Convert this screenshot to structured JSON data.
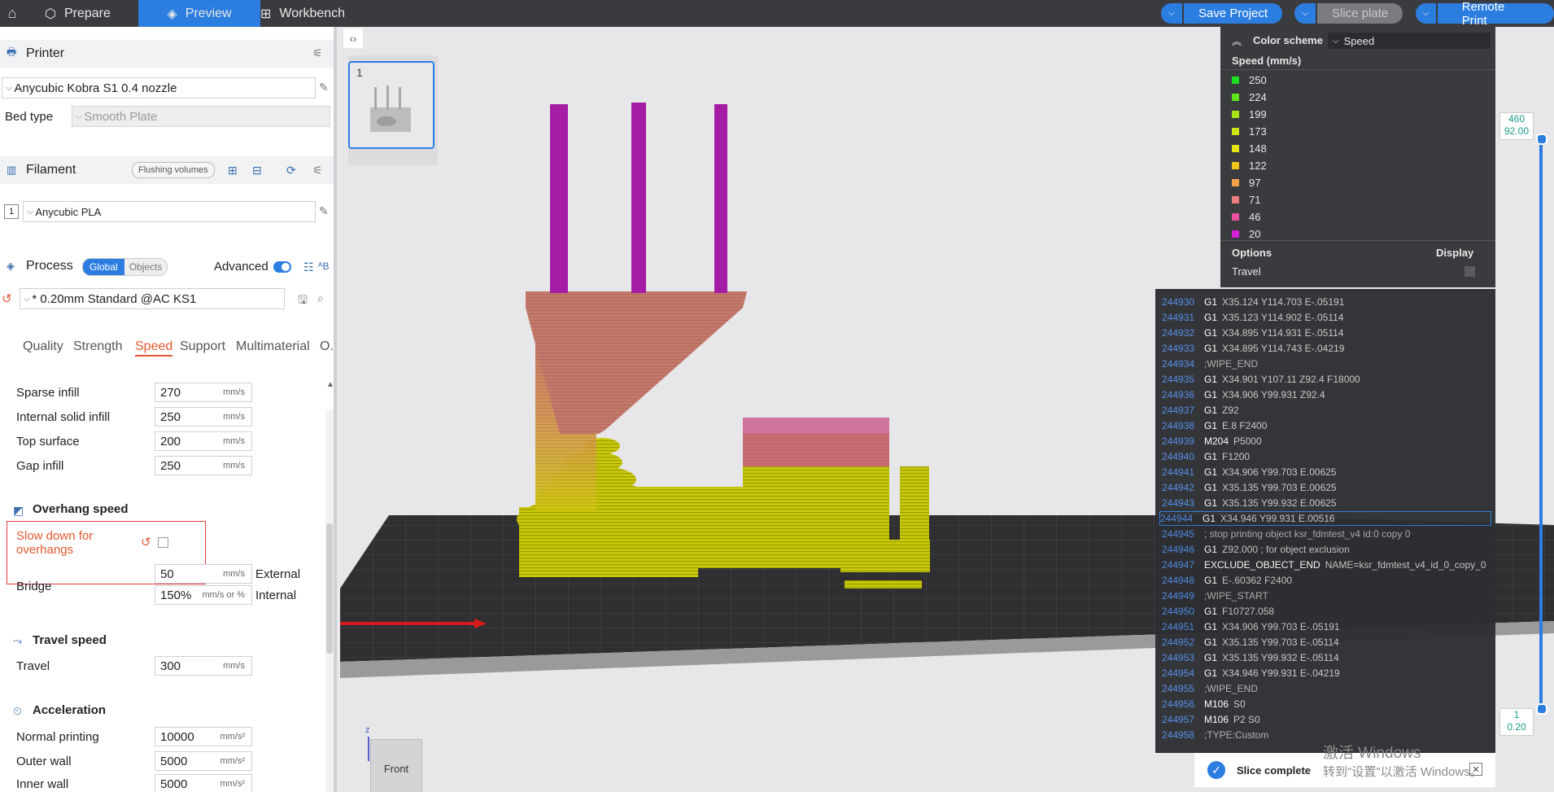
{
  "topbar": {
    "tabs": [
      {
        "label": "Prepare",
        "icon": "cube-icon"
      },
      {
        "label": "Preview",
        "icon": "layers-icon"
      },
      {
        "label": "Workbench",
        "icon": "grid-icon"
      }
    ],
    "save_project": "Save Project",
    "slice_plate": "Slice plate",
    "remote_print": "Remote Print"
  },
  "printer": {
    "title": "Printer",
    "name": "Anycubic Kobra S1 0.4 nozzle",
    "bed_type_label": "Bed type",
    "bed_type_value": "Smooth Plate"
  },
  "filament": {
    "title": "Filament",
    "flushing": "Flushing volumes",
    "slot": "1",
    "name": "Anycubic PLA"
  },
  "process": {
    "title": "Process",
    "global": "Global",
    "objects": "Objects",
    "advanced": "Advanced",
    "preset": "* 0.20mm Standard @AC KS1",
    "tabs": [
      "Quality",
      "Strength",
      "Speed",
      "Support",
      "Multimaterial",
      "O..."
    ],
    "active_tab": "Speed"
  },
  "speed": {
    "sparse_infill": {
      "label": "Sparse infill",
      "value": "270",
      "unit": "mm/s"
    },
    "internal_solid_infill": {
      "label": "Internal solid infill",
      "value": "250",
      "unit": "mm/s"
    },
    "top_surface": {
      "label": "Top surface",
      "value": "200",
      "unit": "mm/s"
    },
    "gap_infill": {
      "label": "Gap infill",
      "value": "250",
      "unit": "mm/s"
    },
    "overhang_title": "Overhang speed",
    "slow_down_line1": "Slow down for",
    "slow_down_line2": "overhangs",
    "bridge": {
      "label": "Bridge",
      "external_value": "50",
      "external_unit": "mm/s",
      "external_label": "External",
      "internal_value": "150%",
      "internal_unit": "mm/s or %",
      "internal_label": "Internal"
    },
    "travel_title": "Travel speed",
    "travel": {
      "label": "Travel",
      "value": "300",
      "unit": "mm/s"
    },
    "accel_title": "Acceleration",
    "normal_printing": {
      "label": "Normal printing",
      "value": "10000",
      "unit": "mm/s²"
    },
    "outer_wall": {
      "label": "Outer wall",
      "value": "5000",
      "unit": "mm/s²"
    },
    "inner_wall": {
      "label": "Inner wall",
      "value": "5000",
      "unit": "mm/s²"
    }
  },
  "viewport": {
    "plate_number": "1",
    "axis_z": "z",
    "front": "Front"
  },
  "legend": {
    "color_scheme_label": "Color scheme",
    "color_scheme_value": "Speed",
    "header": "Speed (mm/s)",
    "items": [
      {
        "value": "250",
        "color": "#1fe01f"
      },
      {
        "value": "224",
        "color": "#5fe31a"
      },
      {
        "value": "199",
        "color": "#a6e417"
      },
      {
        "value": "173",
        "color": "#cfe415"
      },
      {
        "value": "148",
        "color": "#e6e112"
      },
      {
        "value": "122",
        "color": "#f0c419"
      },
      {
        "value": "97",
        "color": "#f2a347"
      },
      {
        "value": "71",
        "color": "#ef7f7f"
      },
      {
        "value": "46",
        "color": "#ec4f9f"
      },
      {
        "value": "20",
        "color": "#d61fd6"
      }
    ],
    "options": "Options",
    "display": "Display",
    "travel": "Travel"
  },
  "gcode": [
    {
      "n": "244930",
      "cmd": "G1",
      "args": "X35.124 Y114.703 E-.05191"
    },
    {
      "n": "244931",
      "cmd": "G1",
      "args": "X35.123 Y114.902 E-.05114"
    },
    {
      "n": "244932",
      "cmd": "G1",
      "args": "X34.895 Y114.931 E-.05114"
    },
    {
      "n": "244933",
      "cmd": "G1",
      "args": "X34.895 Y114.743 E-.04219"
    },
    {
      "n": "244934",
      "cmd": "",
      "args": ";WIPE_END"
    },
    {
      "n": "244935",
      "cmd": "G1",
      "args": "X34.901 Y107.11 Z92.4 F18000"
    },
    {
      "n": "244936",
      "cmd": "G1",
      "args": "X34.906 Y99.931 Z92.4"
    },
    {
      "n": "244937",
      "cmd": "G1",
      "args": "Z92"
    },
    {
      "n": "244938",
      "cmd": "G1",
      "args": "E.8 F2400"
    },
    {
      "n": "244939",
      "cmd": "M204",
      "args": "P5000"
    },
    {
      "n": "244940",
      "cmd": "G1",
      "args": "F1200"
    },
    {
      "n": "244941",
      "cmd": "G1",
      "args": "X34.906 Y99.703 E.00625"
    },
    {
      "n": "244942",
      "cmd": "G1",
      "args": "X35.135 Y99.703 E.00625"
    },
    {
      "n": "244943",
      "cmd": "G1",
      "args": "X35.135 Y99.932 E.00625"
    },
    {
      "n": "244944",
      "cmd": "G1",
      "args": "X34.946 Y99.931 E.00516",
      "selected": true
    },
    {
      "n": "244945",
      "cmd": "",
      "args": "; stop printing object ksr_fdmtest_v4 id:0 copy 0"
    },
    {
      "n": "244946",
      "cmd": "G1",
      "args": "Z92.000 ; for object exclusion"
    },
    {
      "n": "244947",
      "cmd": "EXCLUDE_OBJECT_END",
      "args": "NAME=ksr_fdmtest_v4_id_0_copy_0"
    },
    {
      "n": "244948",
      "cmd": "G1",
      "args": "E-.60362 F2400"
    },
    {
      "n": "244949",
      "cmd": "",
      "args": ";WIPE_START"
    },
    {
      "n": "244950",
      "cmd": "G1",
      "args": "F10727.058"
    },
    {
      "n": "244951",
      "cmd": "G1",
      "args": "X34.906 Y99.703 E-.05191"
    },
    {
      "n": "244952",
      "cmd": "G1",
      "args": "X35.135 Y99.703 E-.05114"
    },
    {
      "n": "244953",
      "cmd": "G1",
      "args": "X35.135 Y99.932 E-.05114"
    },
    {
      "n": "244954",
      "cmd": "G1",
      "args": "X34.946 Y99.931 E-.04219"
    },
    {
      "n": "244955",
      "cmd": "",
      "args": ";WIPE_END"
    },
    {
      "n": "244956",
      "cmd": "M106",
      "args": "S0"
    },
    {
      "n": "244957",
      "cmd": "M106",
      "args": "P2 S0"
    },
    {
      "n": "244958",
      "cmd": "",
      "args": ";TYPE:Custom"
    }
  ],
  "layer_slider": {
    "top_layer": "460",
    "top_height": "92.00",
    "bottom_layer": "1",
    "bottom_height": "0.20"
  },
  "toast": {
    "text": "Slice complete"
  },
  "watermark": {
    "line1": "激活 Windows",
    "line2": "转到\"设置\"以激活 Windows。"
  }
}
